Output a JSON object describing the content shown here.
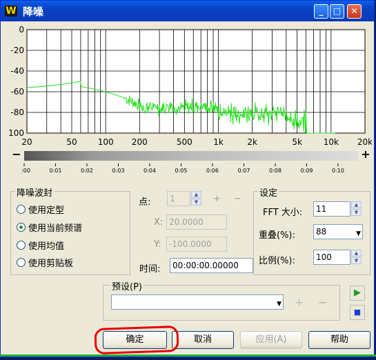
{
  "window": {
    "title": "降噪",
    "icon": "W",
    "min": "_",
    "max": "□",
    "close": "✕"
  },
  "graph": {
    "y_labels": [
      "0",
      "-20",
      "-40",
      "-60",
      "-80",
      "100"
    ],
    "freq_labels": [
      "20",
      "50",
      "100",
      "200",
      "500",
      "1k",
      "2k",
      "5k",
      "10k",
      "20k"
    ],
    "time_labels": [
      "0:00",
      "0:01",
      "0:02",
      "0:03",
      "0:04",
      "0:05",
      "0:06",
      "0:07",
      "0:08",
      "0:09",
      "0:10"
    ],
    "zoom_out": "−",
    "zoom_in": "+"
  },
  "noise_envelope": {
    "title": "降噪波封",
    "options": [
      "使用定型",
      "使用当前频谱",
      "使用均值",
      "使用剪贴板"
    ],
    "selected": 1
  },
  "points": {
    "point_label": "点:",
    "point_value": "1",
    "x_label": "X:",
    "x_value": "20.0000",
    "y_label": "Y:",
    "y_value": "-100.0000",
    "time_label": "时间:",
    "time_value": "00:00:00.00000"
  },
  "settings": {
    "title": "设定",
    "fft_label": "FFT 大小:",
    "fft_value": "11",
    "overlap_label": "重叠(%):",
    "overlap_value": "88",
    "ratio_label": "比例(%):",
    "ratio_value": "100"
  },
  "preset": {
    "title": "预设(P)",
    "value": ""
  },
  "buttons": {
    "ok": "确定",
    "cancel": "取消",
    "apply": "应用(A)",
    "help": "帮助"
  }
}
